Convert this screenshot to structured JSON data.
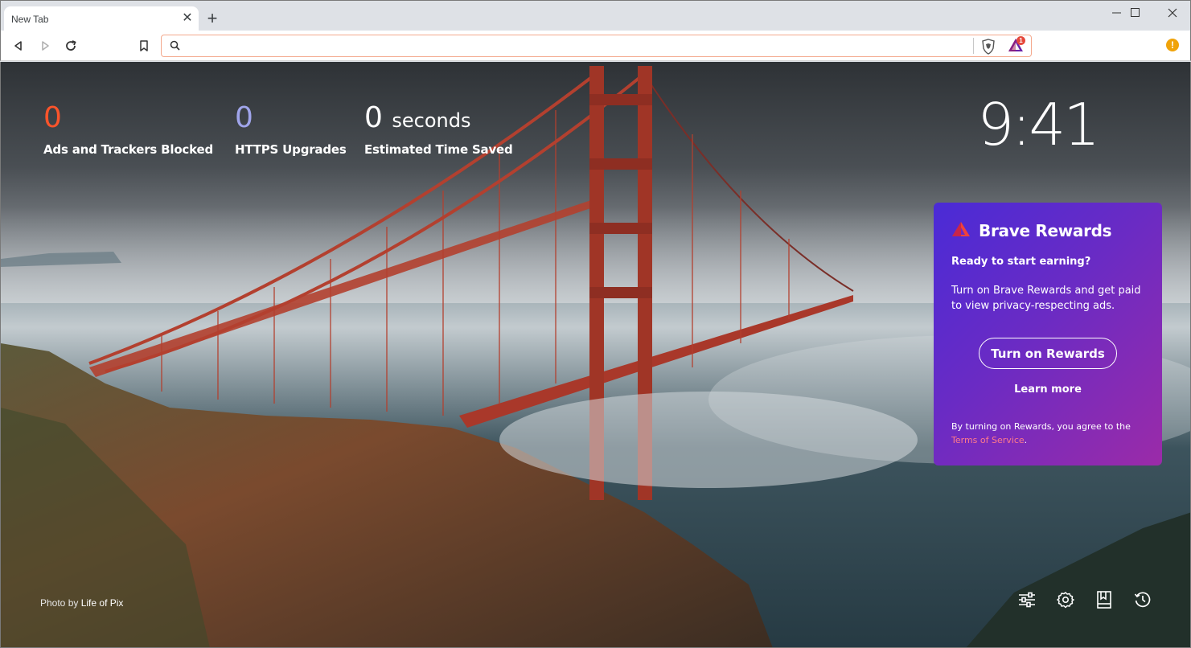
{
  "browser": {
    "tab": {
      "title": "New Tab",
      "close_glyph": "✕"
    },
    "new_tab_glyph": "+",
    "window_controls": [
      "minimize-icon",
      "maximize-icon",
      "close-icon"
    ],
    "toolbar": {
      "icons": [
        "back-icon",
        "forward-icon",
        "reload-icon",
        "bookmark-icon"
      ],
      "omnibox": {
        "value": "",
        "placeholder": ""
      },
      "rewards_badge": "1",
      "warning_glyph": "!"
    }
  },
  "new_tab_page": {
    "stats": [
      {
        "value": "0",
        "label": "Ads and Trackers Blocked",
        "color": "#fb542b"
      },
      {
        "value": "0",
        "label": "HTTPS Upgrades",
        "color": "#a0a5eb"
      },
      {
        "value": "0",
        "unit": "seconds",
        "label": "Estimated Time Saved",
        "color": "#ffffff"
      }
    ],
    "clock": "9:41",
    "rewards_card": {
      "title": "Brave Rewards",
      "subtitle": "Ready to start earning?",
      "body": "Turn on Brave Rewards and get paid to view privacy-respecting ads.",
      "button": "Turn on Rewards",
      "learn_more": "Learn more",
      "terms_prefix": "By turning on Rewards, you agree to the",
      "terms_link": "Terms of Service",
      "terms_suffix": "."
    },
    "photo_credit": {
      "prefix": "Photo by",
      "author": "Life of Pix"
    },
    "bottom_icons": [
      "customize-icon",
      "settings-icon",
      "bookmarks-icon",
      "history-icon"
    ]
  },
  "colors": {
    "accent_orange": "#fb542b",
    "rewards_gradient_start": "#4a2bd6",
    "rewards_gradient_end": "#9b2ba8",
    "omnibox_border": "#f4a98d"
  }
}
